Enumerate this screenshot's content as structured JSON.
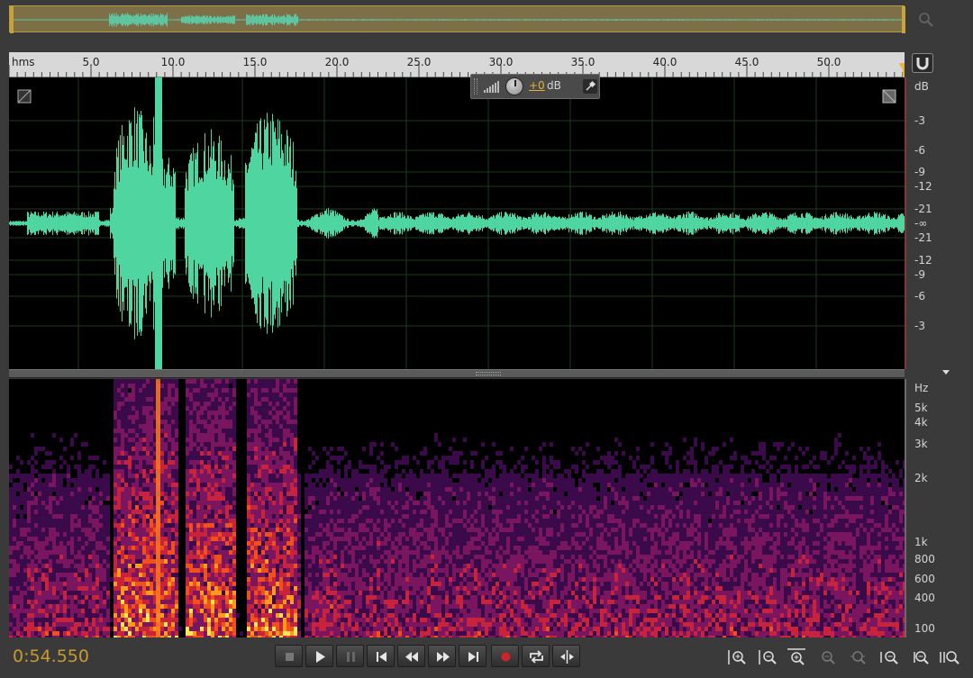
{
  "overview": {
    "label": "overview-waveform"
  },
  "ruler": {
    "unit_label": "hms",
    "ticks": [
      "5.0",
      "10.0",
      "15.0",
      "20.0",
      "25.0",
      "30.0",
      "35.0",
      "40.0",
      "45.0",
      "50.0"
    ]
  },
  "hud": {
    "value": "+0",
    "unit": "dB"
  },
  "amplitude_scale": {
    "header": "dB",
    "labels": [
      "-3",
      "-6",
      "-9",
      "-12",
      "-21",
      "-∞",
      "-21",
      "-12",
      "-9",
      "-6",
      "-3"
    ]
  },
  "frequency_scale": {
    "header": "Hz",
    "labels": [
      "5k",
      "4k",
      "3k",
      "2k",
      "1k",
      "800",
      "600",
      "400",
      "100"
    ]
  },
  "transport": {
    "timecode": "0:54.550",
    "buttons": [
      "stop",
      "play",
      "pause",
      "move-to-previous",
      "rewind",
      "fast-forward",
      "move-to-next",
      "record",
      "loop-playback",
      "skip-selection"
    ]
  },
  "zoom_tools": [
    "zoom-in-amplitude",
    "zoom-out-amplitude",
    "zoom-in-time",
    "zoom-out-time",
    "zoom-out-full",
    "zoom-in-at-in-point",
    "zoom-in-at-out-point",
    "zoom-to-selection"
  ],
  "colors": {
    "waveform": "#4fd6a0",
    "timecode": "#c99a2e",
    "record": "#d0222a",
    "hud_value": "#e6b233",
    "overview_bg": "#7d7048",
    "playhead": "#e8b43a"
  }
}
